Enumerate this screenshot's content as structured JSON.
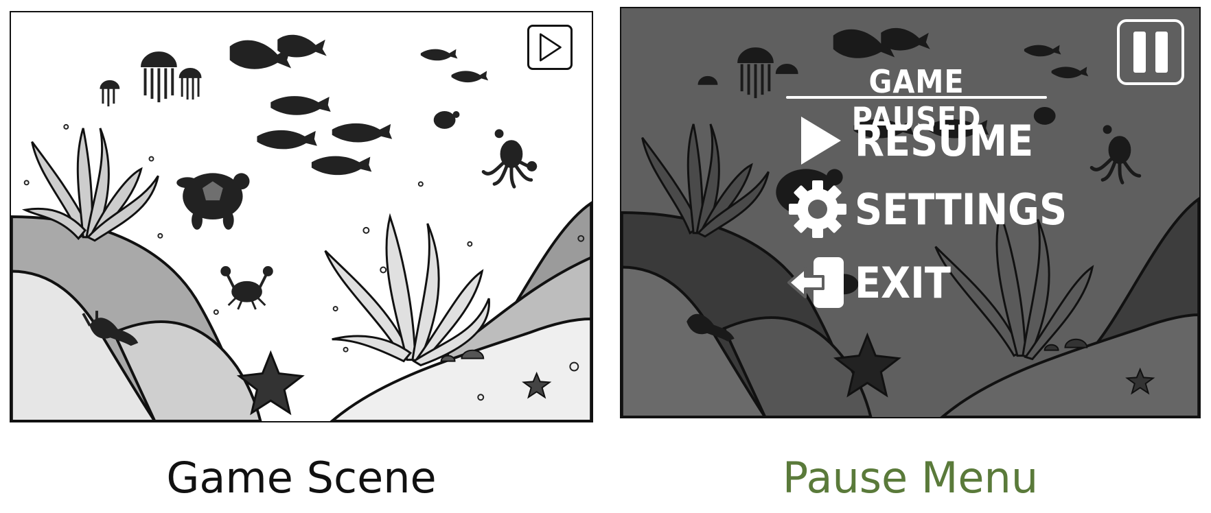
{
  "captions": {
    "left": "Game Scene",
    "right": "Pause Menu"
  },
  "colors": {
    "right_caption": "#5a7a3a",
    "overlay": "#5f5f5f"
  },
  "pause_menu": {
    "title": "GAME PAUSED",
    "items": [
      {
        "label": "RESUME",
        "icon": "play-icon"
      },
      {
        "label": "SETTINGS",
        "icon": "gear-icon"
      },
      {
        "label": "EXIT",
        "icon": "exit-door-icon"
      }
    ]
  },
  "icons": {
    "scene_button": "play-icon",
    "pause_button": "pause-icon"
  }
}
